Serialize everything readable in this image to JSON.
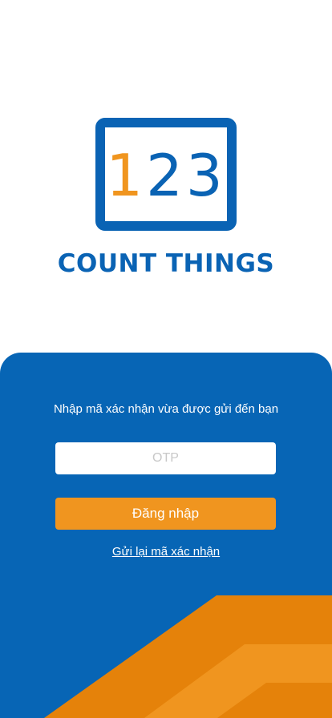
{
  "logo": {
    "digit_1": "1",
    "digit_2": "2",
    "digit_3": "3",
    "brand_name": "COUNT THINGS"
  },
  "otp_form": {
    "instruction": "Nhập mã xác nhận vừa được gửi đến bạn",
    "otp_placeholder": "OTP",
    "otp_value": "",
    "login_label": "Đăng nhập",
    "resend_label": "Gửi lại mã xác nhận"
  },
  "colors": {
    "brand_blue": "#0a63b4",
    "panel_blue": "#0765b5",
    "accent_orange": "#f0951f",
    "dark_orange": "#e5820a"
  }
}
